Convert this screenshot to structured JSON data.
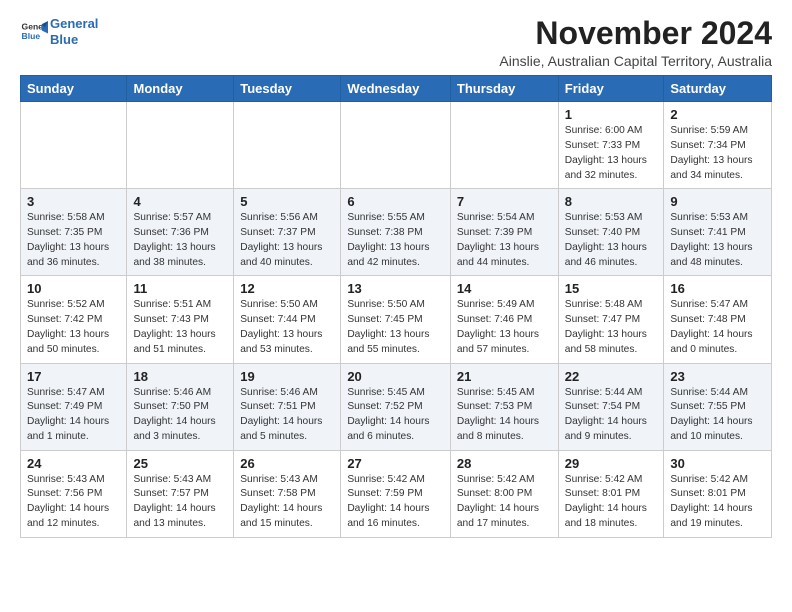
{
  "header": {
    "logo_line1": "General",
    "logo_line2": "Blue",
    "month": "November 2024",
    "location": "Ainslie, Australian Capital Territory, Australia"
  },
  "weekdays": [
    "Sunday",
    "Monday",
    "Tuesday",
    "Wednesday",
    "Thursday",
    "Friday",
    "Saturday"
  ],
  "weeks": [
    [
      {
        "day": "",
        "info": ""
      },
      {
        "day": "",
        "info": ""
      },
      {
        "day": "",
        "info": ""
      },
      {
        "day": "",
        "info": ""
      },
      {
        "day": "",
        "info": ""
      },
      {
        "day": "1",
        "info": "Sunrise: 6:00 AM\nSunset: 7:33 PM\nDaylight: 13 hours\nand 32 minutes."
      },
      {
        "day": "2",
        "info": "Sunrise: 5:59 AM\nSunset: 7:34 PM\nDaylight: 13 hours\nand 34 minutes."
      }
    ],
    [
      {
        "day": "3",
        "info": "Sunrise: 5:58 AM\nSunset: 7:35 PM\nDaylight: 13 hours\nand 36 minutes."
      },
      {
        "day": "4",
        "info": "Sunrise: 5:57 AM\nSunset: 7:36 PM\nDaylight: 13 hours\nand 38 minutes."
      },
      {
        "day": "5",
        "info": "Sunrise: 5:56 AM\nSunset: 7:37 PM\nDaylight: 13 hours\nand 40 minutes."
      },
      {
        "day": "6",
        "info": "Sunrise: 5:55 AM\nSunset: 7:38 PM\nDaylight: 13 hours\nand 42 minutes."
      },
      {
        "day": "7",
        "info": "Sunrise: 5:54 AM\nSunset: 7:39 PM\nDaylight: 13 hours\nand 44 minutes."
      },
      {
        "day": "8",
        "info": "Sunrise: 5:53 AM\nSunset: 7:40 PM\nDaylight: 13 hours\nand 46 minutes."
      },
      {
        "day": "9",
        "info": "Sunrise: 5:53 AM\nSunset: 7:41 PM\nDaylight: 13 hours\nand 48 minutes."
      }
    ],
    [
      {
        "day": "10",
        "info": "Sunrise: 5:52 AM\nSunset: 7:42 PM\nDaylight: 13 hours\nand 50 minutes."
      },
      {
        "day": "11",
        "info": "Sunrise: 5:51 AM\nSunset: 7:43 PM\nDaylight: 13 hours\nand 51 minutes."
      },
      {
        "day": "12",
        "info": "Sunrise: 5:50 AM\nSunset: 7:44 PM\nDaylight: 13 hours\nand 53 minutes."
      },
      {
        "day": "13",
        "info": "Sunrise: 5:50 AM\nSunset: 7:45 PM\nDaylight: 13 hours\nand 55 minutes."
      },
      {
        "day": "14",
        "info": "Sunrise: 5:49 AM\nSunset: 7:46 PM\nDaylight: 13 hours\nand 57 minutes."
      },
      {
        "day": "15",
        "info": "Sunrise: 5:48 AM\nSunset: 7:47 PM\nDaylight: 13 hours\nand 58 minutes."
      },
      {
        "day": "16",
        "info": "Sunrise: 5:47 AM\nSunset: 7:48 PM\nDaylight: 14 hours\nand 0 minutes."
      }
    ],
    [
      {
        "day": "17",
        "info": "Sunrise: 5:47 AM\nSunset: 7:49 PM\nDaylight: 14 hours\nand 1 minute."
      },
      {
        "day": "18",
        "info": "Sunrise: 5:46 AM\nSunset: 7:50 PM\nDaylight: 14 hours\nand 3 minutes."
      },
      {
        "day": "19",
        "info": "Sunrise: 5:46 AM\nSunset: 7:51 PM\nDaylight: 14 hours\nand 5 minutes."
      },
      {
        "day": "20",
        "info": "Sunrise: 5:45 AM\nSunset: 7:52 PM\nDaylight: 14 hours\nand 6 minutes."
      },
      {
        "day": "21",
        "info": "Sunrise: 5:45 AM\nSunset: 7:53 PM\nDaylight: 14 hours\nand 8 minutes."
      },
      {
        "day": "22",
        "info": "Sunrise: 5:44 AM\nSunset: 7:54 PM\nDaylight: 14 hours\nand 9 minutes."
      },
      {
        "day": "23",
        "info": "Sunrise: 5:44 AM\nSunset: 7:55 PM\nDaylight: 14 hours\nand 10 minutes."
      }
    ],
    [
      {
        "day": "24",
        "info": "Sunrise: 5:43 AM\nSunset: 7:56 PM\nDaylight: 14 hours\nand 12 minutes."
      },
      {
        "day": "25",
        "info": "Sunrise: 5:43 AM\nSunset: 7:57 PM\nDaylight: 14 hours\nand 13 minutes."
      },
      {
        "day": "26",
        "info": "Sunrise: 5:43 AM\nSunset: 7:58 PM\nDaylight: 14 hours\nand 15 minutes."
      },
      {
        "day": "27",
        "info": "Sunrise: 5:42 AM\nSunset: 7:59 PM\nDaylight: 14 hours\nand 16 minutes."
      },
      {
        "day": "28",
        "info": "Sunrise: 5:42 AM\nSunset: 8:00 PM\nDaylight: 14 hours\nand 17 minutes."
      },
      {
        "day": "29",
        "info": "Sunrise: 5:42 AM\nSunset: 8:01 PM\nDaylight: 14 hours\nand 18 minutes."
      },
      {
        "day": "30",
        "info": "Sunrise: 5:42 AM\nSunset: 8:01 PM\nDaylight: 14 hours\nand 19 minutes."
      }
    ]
  ]
}
